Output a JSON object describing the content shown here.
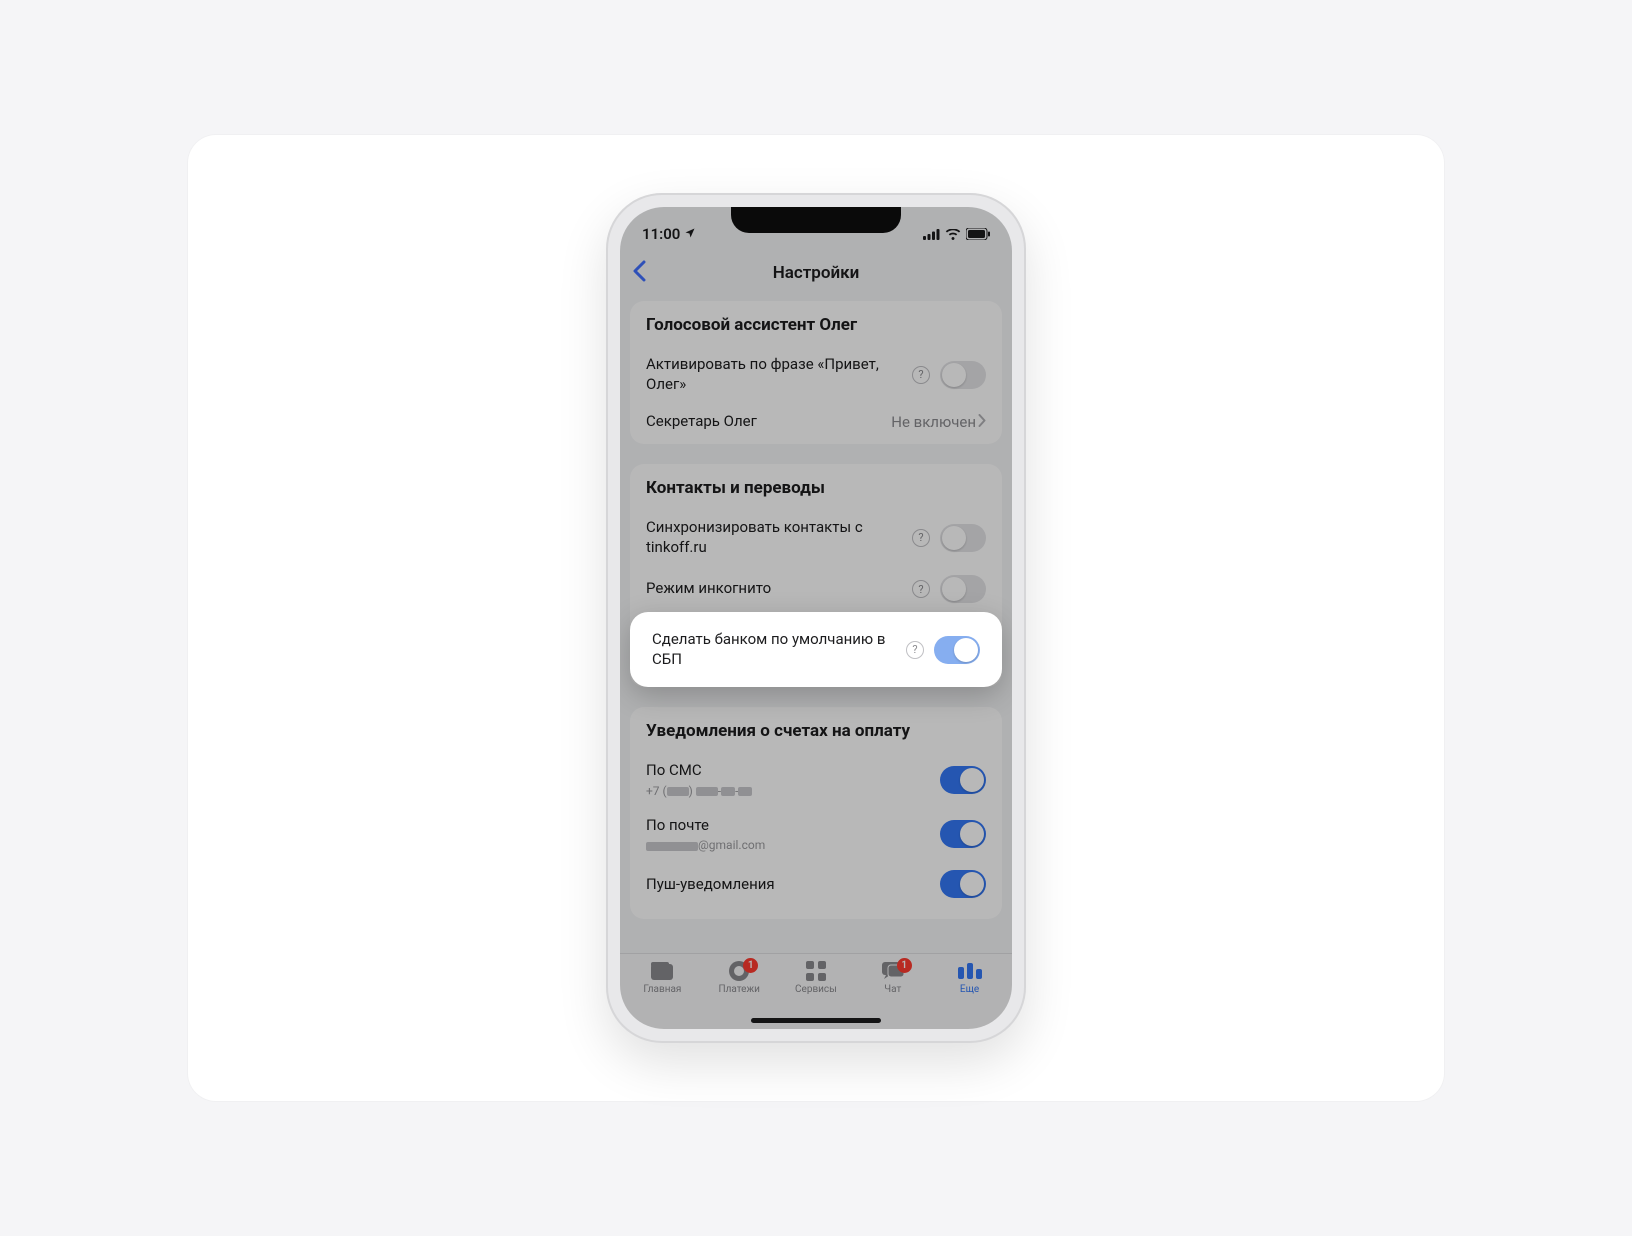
{
  "status": {
    "time": "11:00"
  },
  "nav": {
    "title": "Настройки"
  },
  "section_assistant": {
    "title": "Голосовой ассистент Олег",
    "activate_label": "Активировать по фразе «Привет, Олег»",
    "secretary_label": "Секретарь Олег",
    "secretary_value": "Не включен"
  },
  "section_contacts": {
    "title": "Контакты и переводы",
    "sync_label": "Синхронизировать контакты с tinkoff.ru",
    "incognito_label": "Режим инкогнито",
    "sbp_label": "Сделать банком по умолчанию в СБП"
  },
  "section_notifications": {
    "title": "Уведомления о счетах на оплату",
    "sms_label": "По СМС",
    "sms_sub_prefix": "+7 (",
    "email_label": "По почте",
    "email_sub_suffix": "@gmail.com",
    "push_label": "Пуш-уведомления"
  },
  "tabs": {
    "home": "Главная",
    "payments": "Платежи",
    "services": "Сервисы",
    "chat": "Чат",
    "more": "Еще",
    "payments_badge": "1",
    "chat_badge": "1"
  }
}
